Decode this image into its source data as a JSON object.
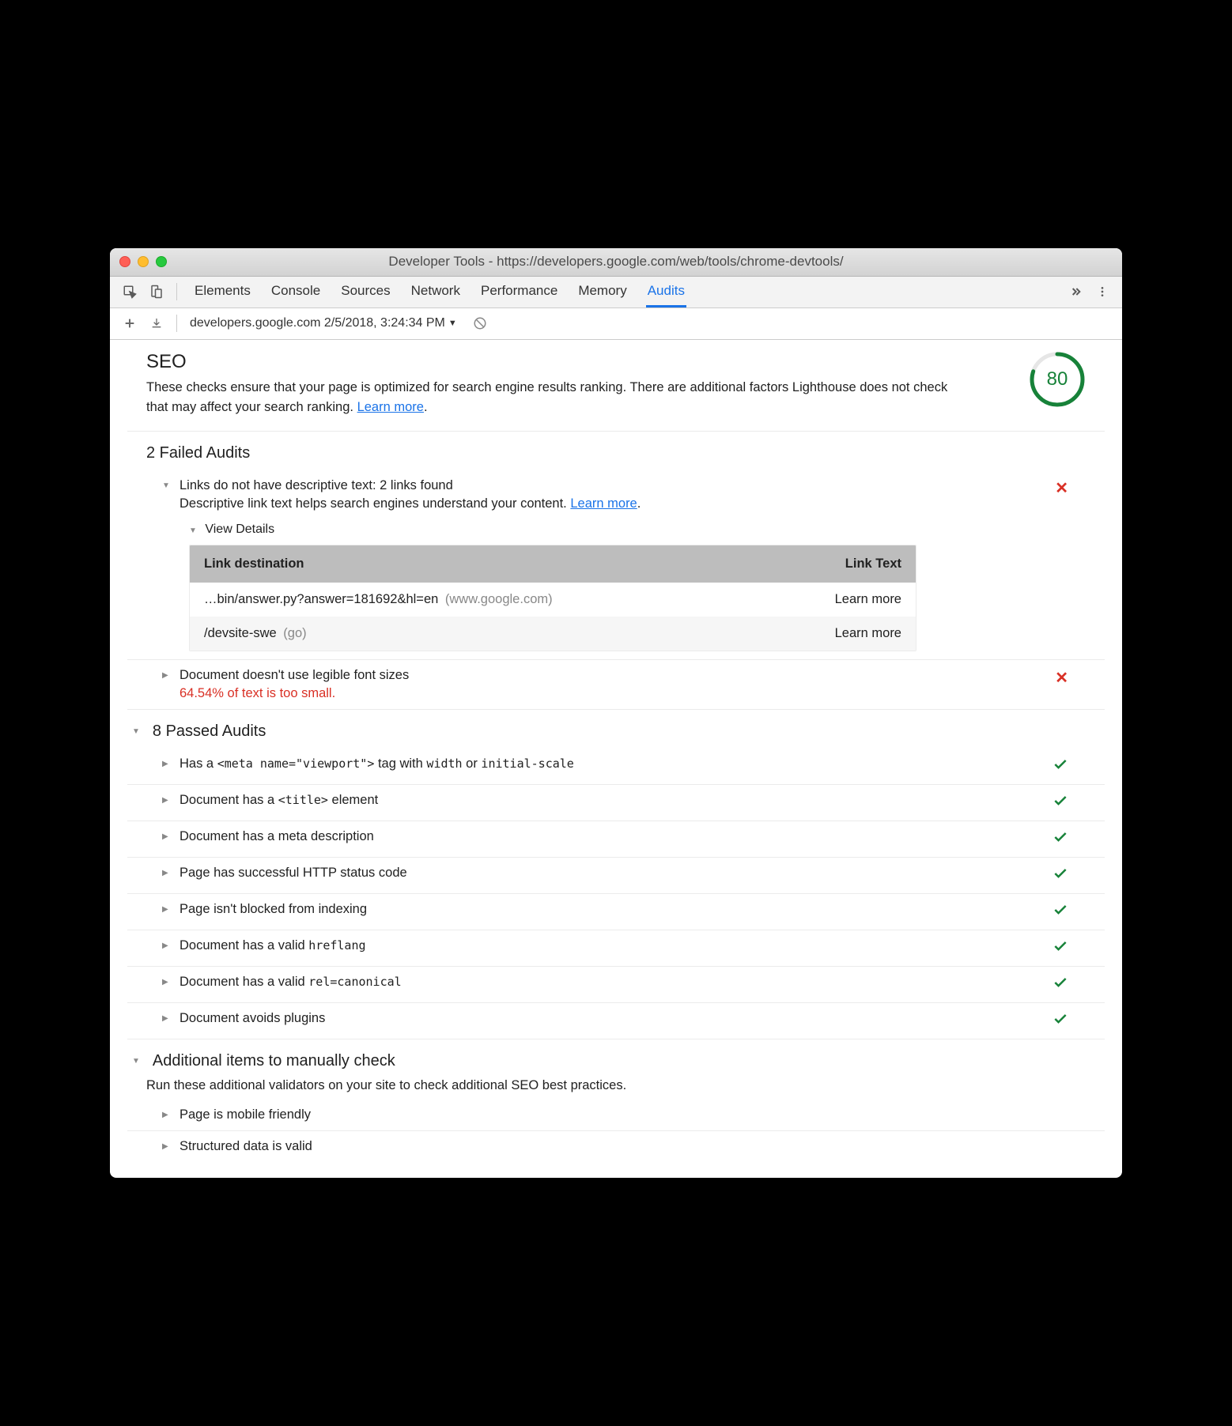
{
  "window": {
    "title": "Developer Tools - https://developers.google.com/web/tools/chrome-devtools/"
  },
  "tabs": [
    "Elements",
    "Console",
    "Sources",
    "Network",
    "Performance",
    "Memory",
    "Audits"
  ],
  "active_tab": "Audits",
  "toolbar": {
    "run_label": "developers.google.com 2/5/2018, 3:24:34 PM"
  },
  "seo": {
    "title": "SEO",
    "description_pre": "These checks ensure that your page is optimized for search engine results ranking. There are additional factors Lighthouse does not check that may affect your search ranking. ",
    "learn_more": "Learn more",
    "score": 80
  },
  "failed": {
    "title": "2 Failed Audits",
    "items": [
      {
        "title": "Links do not have descriptive text: 2 links found",
        "desc_pre": "Descriptive link text helps search engines understand your content. ",
        "learn_more": "Learn more",
        "details_title": "View Details",
        "table": {
          "col1": "Link destination",
          "col2": "Link Text",
          "rows": [
            {
              "dest": "…bin/answer.py?answer=181692&hl=en",
              "host": "(www.google.com)",
              "text": "Learn more"
            },
            {
              "dest": "/devsite-swe",
              "host": "(go)",
              "text": "Learn more"
            }
          ]
        }
      },
      {
        "title": "Document doesn't use legible font sizes",
        "sub_error": "64.54% of text is too small."
      }
    ]
  },
  "passed": {
    "title": "8 Passed Audits",
    "items": [
      {
        "text_pre": "Has a ",
        "code1": "<meta name=\"viewport\">",
        "text_mid": " tag with ",
        "code2": "width",
        "text_mid2": " or ",
        "code3": "initial-scale"
      },
      {
        "text_pre": "Document has a ",
        "code1": "<title>",
        "text_post": " element"
      },
      {
        "text_pre": "Document has a meta description"
      },
      {
        "text_pre": "Page has successful HTTP status code"
      },
      {
        "text_pre": "Page isn't blocked from indexing"
      },
      {
        "text_pre": "Document has a valid ",
        "code1": "hreflang"
      },
      {
        "text_pre": "Document has a valid ",
        "code1": "rel=canonical"
      },
      {
        "text_pre": "Document avoids plugins"
      }
    ]
  },
  "manual": {
    "title": "Additional items to manually check",
    "subtitle": "Run these additional validators on your site to check additional SEO best practices.",
    "items": [
      {
        "title": "Page is mobile friendly"
      },
      {
        "title": "Structured data is valid"
      }
    ]
  }
}
